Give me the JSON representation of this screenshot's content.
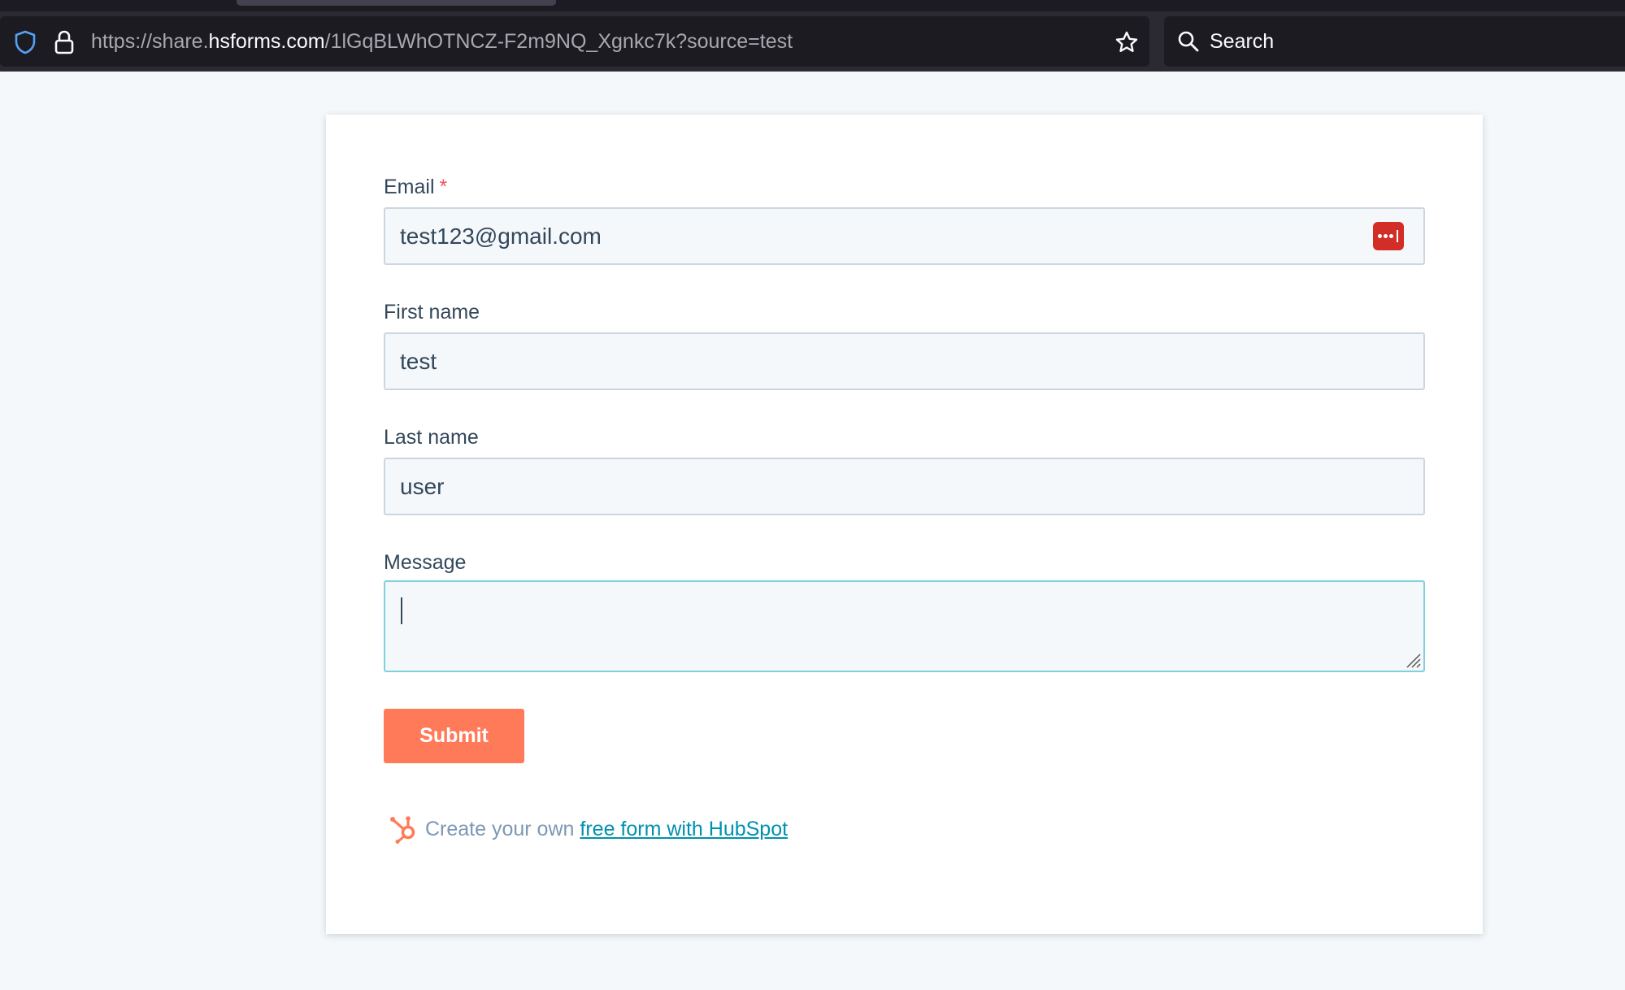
{
  "browser": {
    "url_prefix": "https://share.",
    "url_host": "hsforms.com",
    "url_path": "/1lGqBLWhOTNCZ-F2m9NQ_Xgnkc7k?source=test",
    "search_label": "Search"
  },
  "form": {
    "email": {
      "label": "Email",
      "required_mark": "*",
      "value": "test123@gmail.com"
    },
    "first_name": {
      "label": "First name",
      "value": "test"
    },
    "last_name": {
      "label": "Last name",
      "value": "user"
    },
    "message": {
      "label": "Message",
      "value": ""
    },
    "submit_label": "Submit"
  },
  "footer": {
    "text": "Create your own",
    "link_text": "free form with HubSpot"
  },
  "colors": {
    "accent": "#ff7a59",
    "link": "#0091ae",
    "required": "#f2545b",
    "password_manager": "#d32d27"
  },
  "icons": [
    "shield-icon",
    "lock-icon",
    "bookmark-star-icon",
    "search-icon",
    "password-manager-icon",
    "hubspot-logo-icon"
  ]
}
